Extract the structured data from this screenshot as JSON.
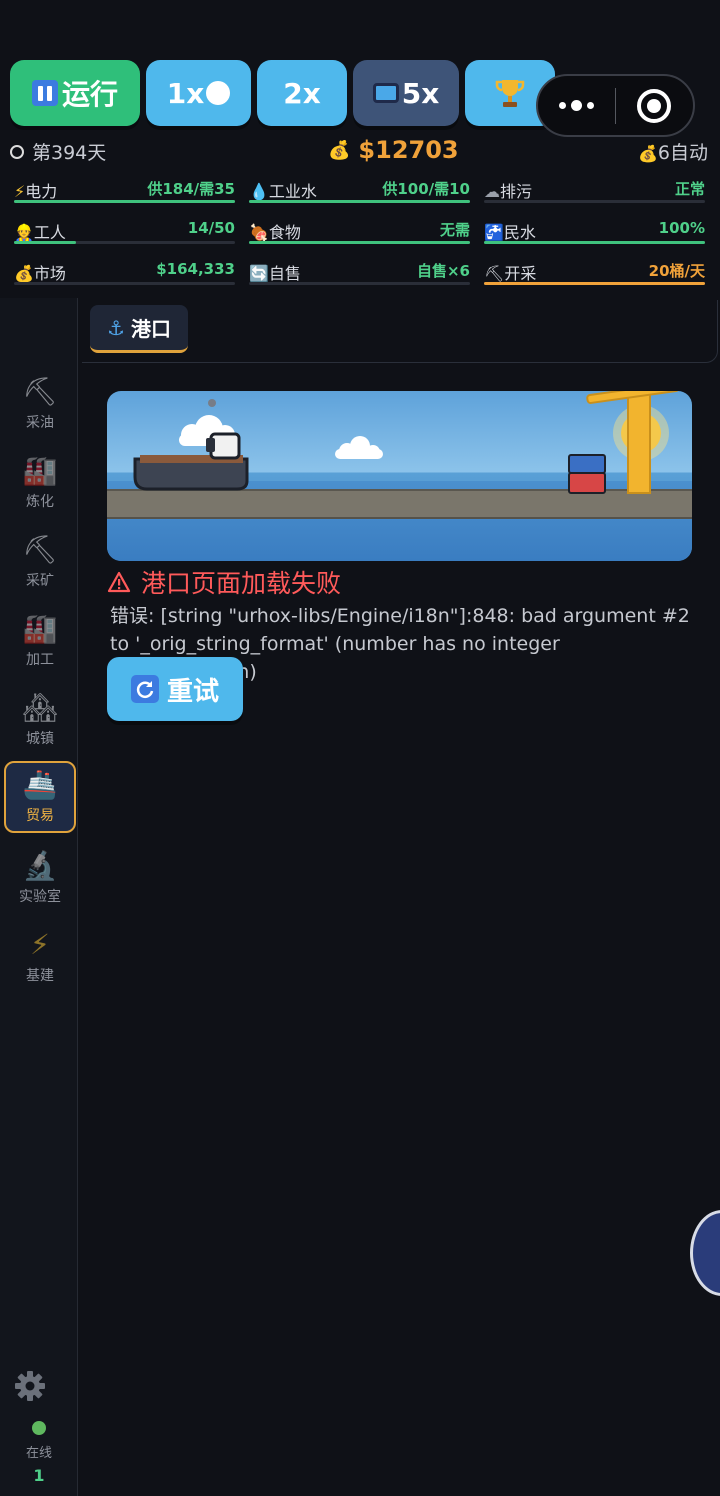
{
  "speed": {
    "run_label": "运行",
    "s1_label": "1x",
    "s2_label": "2x",
    "s5_label": "5x"
  },
  "status": {
    "day": "第394天",
    "money": "$12703",
    "auto": "6自动"
  },
  "resources": [
    {
      "label": "电力",
      "value": "供184/需35",
      "fill": 1.0
    },
    {
      "label": "工业水",
      "value": "供100/需10",
      "fill": 1.0
    },
    {
      "label": "排污",
      "value": "正常",
      "fill": 0.0
    },
    {
      "label": "工人",
      "value": "14/50",
      "fill": 0.28
    },
    {
      "label": "食物",
      "value": "无需",
      "fill": 1.0
    },
    {
      "label": "民水",
      "value": "100%",
      "fill": 1.0
    },
    {
      "label": "市场",
      "value": "$164,333",
      "fill": 0.0
    },
    {
      "label": "自售",
      "value": "自售×6",
      "fill": 0.0
    },
    {
      "label": "开采",
      "value": "20桶/天",
      "fill": 1.0
    }
  ],
  "sidebar": {
    "items": [
      {
        "label": "采油"
      },
      {
        "label": "炼化"
      },
      {
        "label": "采矿"
      },
      {
        "label": "加工"
      },
      {
        "label": "城镇"
      },
      {
        "label": "贸易"
      },
      {
        "label": "实验室"
      },
      {
        "label": "基建"
      }
    ],
    "online_label": "在线",
    "online_count": "1"
  },
  "tab": {
    "label": "港口"
  },
  "error": {
    "title": "港口页面加载失败",
    "message": "错误: [string \"urhox-libs/Engine/i18n\"]:848: bad argument #2 to '_orig_string_format' (number has no integer representation)",
    "retry_label": "重试"
  },
  "colors": {
    "accent_green": "#2fbf7a",
    "accent_blue": "#4fb8ec",
    "money_orange": "#f0a23a",
    "error_red": "#ff5a5a"
  }
}
